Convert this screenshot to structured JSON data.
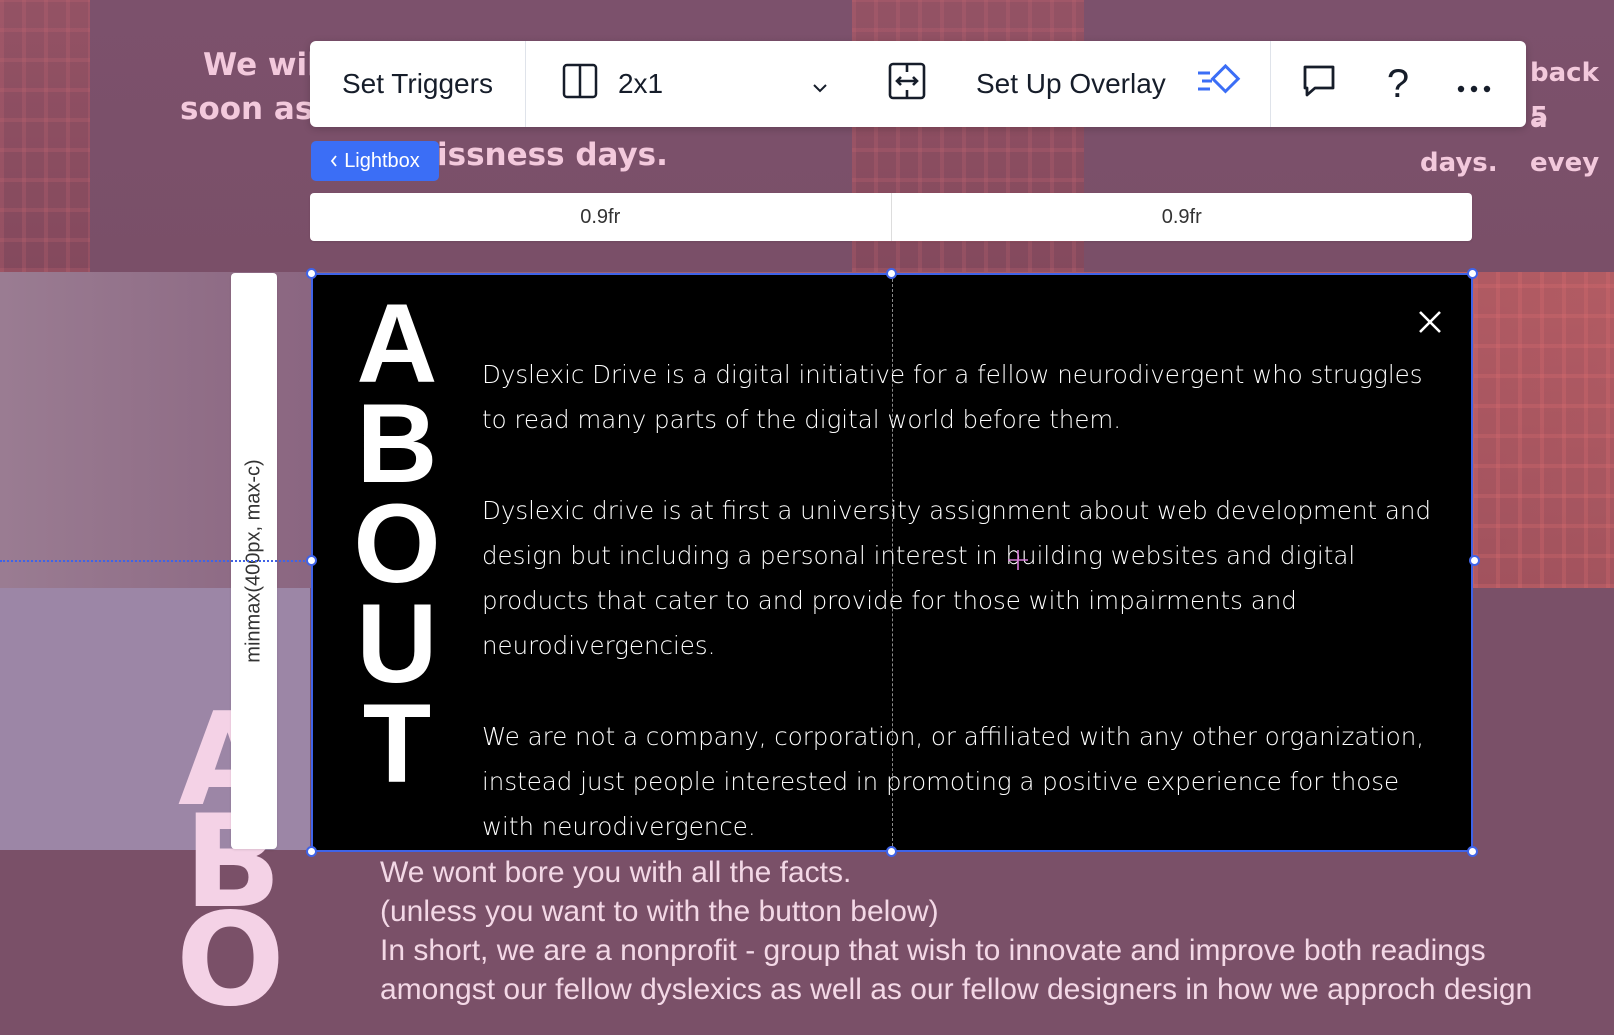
{
  "background": {
    "left_text_line1": "We will",
    "left_text_line2": "soon as",
    "under_badge_text": "issness days.",
    "right_text_line1": "back a",
    "right_text_line2": "5 evey",
    "right_text_line3": "days.",
    "big_letters": [
      "A",
      "B",
      "O"
    ],
    "paragraph": [
      "We wont bore you with all the facts.",
      "(unless you want to with the button below)",
      "In short, we are a nonprofit - group that wish to innovate and improve both readings",
      "amongst our fellow dyslexics as well as our fellow designers in how we approch design"
    ]
  },
  "toolbar": {
    "set_triggers": "Set Triggers",
    "layout_value": "2x1",
    "set_up_overlay": "Set Up Overlay",
    "help_label": "?"
  },
  "lightbox_badge": {
    "label": "Lightbox"
  },
  "grid": {
    "columns": [
      "0.9fr",
      "0.9fr"
    ],
    "row": "minmax(400px, max-c)"
  },
  "panel": {
    "title_letters": [
      "A",
      "B",
      "O",
      "U",
      "T"
    ],
    "paragraphs": [
      "Dyslexic Drive is a digital initiative for a fellow neurodivergent who struggles to read many parts of the digital world before them.",
      "Dyslexic drive is at first a university assignment about web development and design but including a personal interest in building websites and digital products that cater to and provide for those with impairments and neurodivergencies.",
      "We are not a company, corporation, or affiliated with any other organization, instead just people interested in promoting a positive experience for those with neurodivergence."
    ]
  },
  "colors": {
    "accent": "#3f63e8",
    "badge": "#3b6ef6",
    "overlay_icon": "#3b6ef6",
    "background": "#7a5068"
  },
  "icons": {
    "layout": "columns-icon",
    "dropdown": "chevron-down-icon",
    "stretch": "stretch-icon",
    "overlay": "animation-diamond-icon",
    "comment": "comment-icon",
    "more": "more-icon",
    "close": "close-icon"
  }
}
